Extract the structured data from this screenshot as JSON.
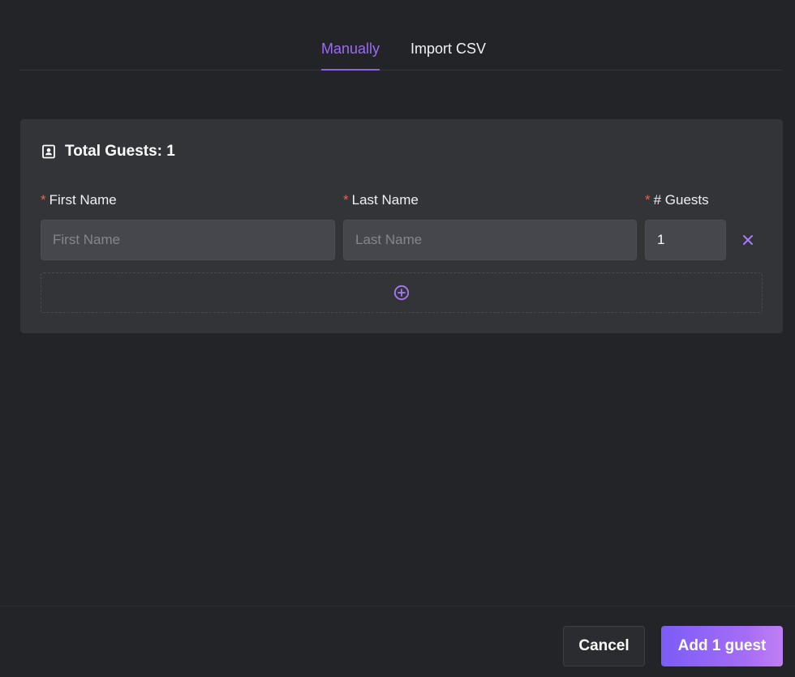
{
  "tabs": [
    {
      "label": "Manually",
      "active": true
    },
    {
      "label": "Import CSV",
      "active": false
    }
  ],
  "card": {
    "title": "Total Guests: 1",
    "title_icon": "contact-book-icon"
  },
  "fields": {
    "first_name": {
      "label": "First Name",
      "placeholder": "First Name",
      "value": ""
    },
    "last_name": {
      "label": "Last Name",
      "placeholder": "Last Name",
      "value": ""
    },
    "guests": {
      "label": "# Guests",
      "value": "1"
    },
    "required_mark": "*"
  },
  "icons": {
    "remove": "close-icon",
    "add_row": "plus-circle-icon"
  },
  "footer": {
    "cancel_label": "Cancel",
    "submit_label": "Add 1 guest"
  },
  "colors": {
    "accent": "#9b6cf0",
    "required": "#e8624a",
    "background": "#222428",
    "card": "#333438"
  }
}
